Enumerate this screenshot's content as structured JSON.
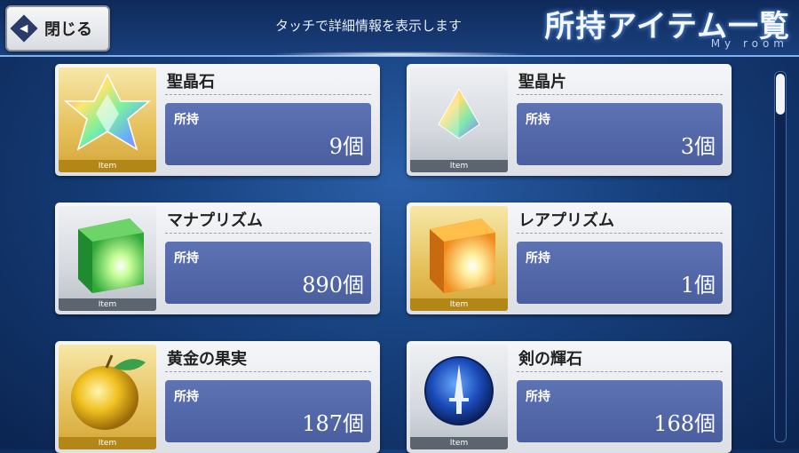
{
  "header": {
    "close_label": "閉じる",
    "hint": "タッチで詳細情報を表示します",
    "title": "所持アイテム一覧",
    "subtitle": "My room"
  },
  "items": [
    {
      "name": "聖晶石",
      "owned_label": "所持",
      "count": "9個",
      "tag": "Item",
      "frame": "gold",
      "icon": "saint-quartz-icon"
    },
    {
      "name": "聖晶片",
      "owned_label": "所持",
      "count": "3個",
      "tag": "Item",
      "frame": "silver",
      "icon": "quartz-fragment-icon"
    },
    {
      "name": "マナプリズム",
      "owned_label": "所持",
      "count": "890個",
      "tag": "Item",
      "frame": "silver",
      "icon": "mana-prism-icon"
    },
    {
      "name": "レアプリズム",
      "owned_label": "所持",
      "count": "1個",
      "tag": "Item",
      "frame": "gold",
      "icon": "rare-prism-icon"
    },
    {
      "name": "黄金の果実",
      "owned_label": "所持",
      "count": "187個",
      "tag": "Item",
      "frame": "gold",
      "icon": "golden-apple-icon"
    },
    {
      "name": "剣の輝石",
      "owned_label": "所持",
      "count": "168個",
      "tag": "Item",
      "frame": "silver",
      "icon": "saber-gem-icon"
    }
  ],
  "colors": {
    "qty_panel": "#5d73b4",
    "header_bg": "#0f2a5a",
    "accent_gold": "#e5c05a"
  }
}
